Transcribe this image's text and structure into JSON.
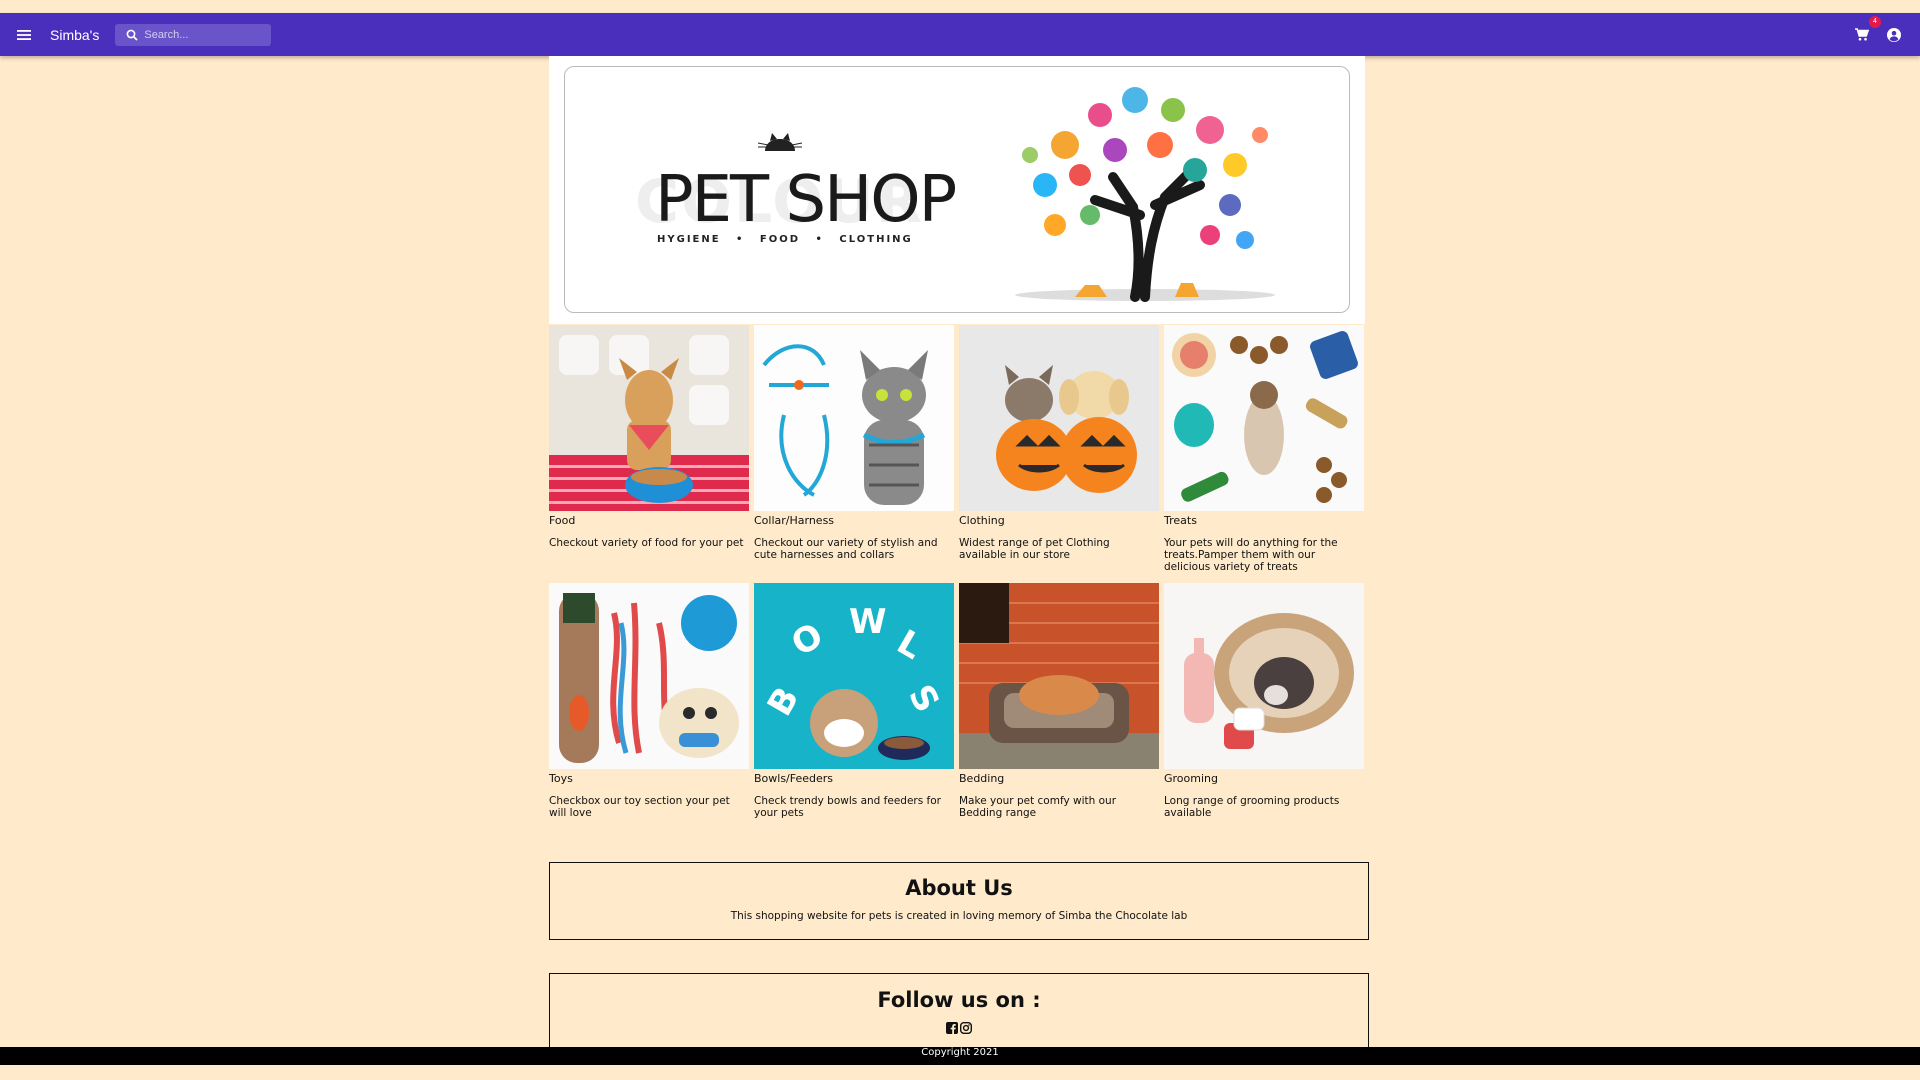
{
  "header": {
    "brand": "Simba's",
    "search_placeholder": "Search...",
    "cart_count": "4"
  },
  "banner": {
    "title": "PET SHOP",
    "subtitle": "HYGIENE  •  FOOD  •  CLOTHING"
  },
  "products": [
    {
      "title": "Food",
      "desc": "Checkout variety of food for your pet",
      "image": "dog with food bowl"
    },
    {
      "title": "Collar/Harness",
      "desc": "Checkout our variety of stylish and cute harnesses and collars",
      "image": "kitten with harness"
    },
    {
      "title": "Clothing",
      "desc": "Widest range of pet Clothing available in our store",
      "image": "cat and dog in pumpkin costumes"
    },
    {
      "title": "Treats",
      "desc": "Your pets will do anything for the treats.Pamper them with our delicious variety of treats",
      "image": "dog surrounded by treats"
    },
    {
      "title": "Toys",
      "desc": "Checkbox our toy section your pet will love",
      "image": "dog toys"
    },
    {
      "title": "Bowls/Feeders",
      "desc": "Check trendy bowls and feeders for your pets",
      "image": "bulldog with bowls"
    },
    {
      "title": "Bedding",
      "desc": "Make your pet comfy with our Bedding range",
      "image": "dog in bed"
    },
    {
      "title": "Grooming",
      "desc": "Long range of grooming products available",
      "image": "bulldog with grooming products"
    }
  ],
  "about": {
    "heading": "About Us",
    "text": "This shopping website for pets is created in loving memory of Simba the Chocolate lab"
  },
  "follow": {
    "heading": "Follow us on :"
  },
  "footer": {
    "text": "Copyright 2021"
  },
  "colors": {
    "background": "#ffeacb",
    "topbar": "#4a2fbd",
    "badge": "#e21b4d"
  }
}
